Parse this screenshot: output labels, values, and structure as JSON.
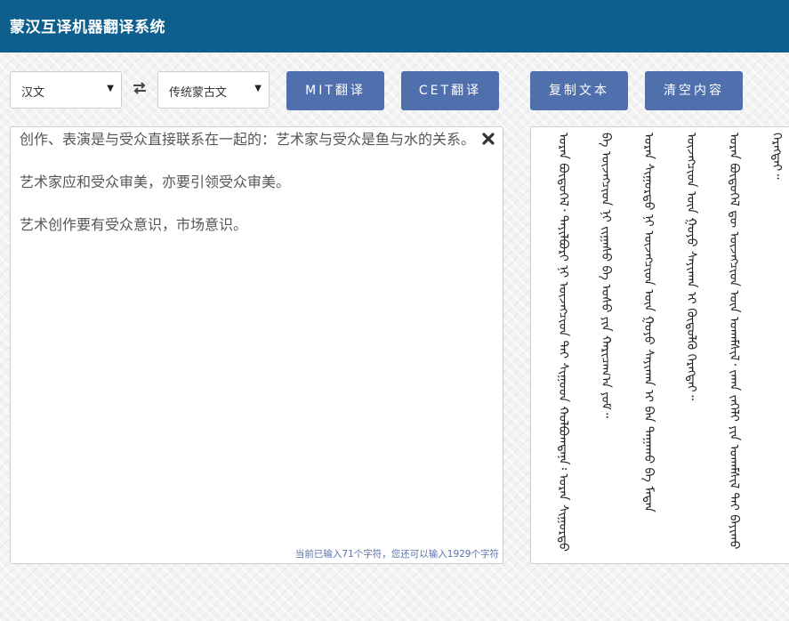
{
  "header": {
    "title": "蒙汉互译机器翻译系统"
  },
  "source_lang": {
    "selected": "汉文"
  },
  "target_lang": {
    "selected": "传统蒙古文"
  },
  "buttons": {
    "mit": "MIT翻译",
    "cet": "CET翻译",
    "copy": "复制文本",
    "clear": "清空内容"
  },
  "input": {
    "paragraphs": [
      "创作、表演是与受众直接联系在一起的：艺术家与受众是鱼与水的关系。",
      "艺术家应和受众审美，亦要引领受众审美。",
      "艺术创作要有受众意识，市场意识。"
    ],
    "counter": "当前已输入71个字符，您还可以输入1929个字符"
  },
  "output": {
    "lines": [
      "ᠤᠷᠠᠨ ᠪᠦᠲᠦᠭᠡᠯ᠂ ᠲᠠᠶᠢᠯᠪᠤᠷᠢ ᠨᠢ ᠦᠵᠡᠭᠴᠢᠳ ᠲᠠᠢ ᠰᠢᠭ᠋ᠤᠳ ᠬᠣᠯᠪᠣᠭᠳᠠᠨᠠ᠄ ᠤᠷᠠᠨ ᠰᠢᠭᠤᠷᠲᠦ ᠪᠠ ᠦᠵᠡᠭᠴᠢᠳ ᠨᠢ ᠵᠢᠭᠠᠰᠤ ᠪᠠ ᠤᠰᠤ ᠶᠢᠨ ᠬᠠᠷᠢᠴᠠᠭ᠎ᠠ ᠶᠤᠮ᠃",
      "ᠤᠷᠠᠨ ᠰᠢᠭᠤᠷᠲᠦ ᠨᠢ ᠦᠵᠡᠭᠴᠢᠳ ᠦᠨ ᠭᠣᠶᠣ ᠰᠠᠶᠢᠬᠠᠨ ᠢ ᠪᠡᠨ ᠳᠠᠭᠠᠬᠤ ᠪᠠ ᠮᠡᠳᠡᠨ ᠦᠵᠡᠭᠴᠢᠳ ᠦᠨ ᠭᠣᠶᠣ ᠰᠠᠶᠢᠬᠠᠨ ᠢ ᠬᠦᠲᠦᠯᠬᠦ ᠬᠡᠷᠡᠭᠲᠡᠢ᠃",
      "ᠤᠷᠠᠨ ᠪᠦᠲᠦᠭᠡᠯ ᠳᠦ ᠦᠵᠡᠭᠴᠢᠳ ᠦᠨ ᠤᠬᠠᠮᠰᠢᠯ᠂ ᠵᠠᠬᠠ ᠵᠡᠭᠡᠯᠢ ᠶᠢᠨ ᠤᠬᠠᠮᠰᠢᠯ ᠲᠠᠢ ᠪᠠᠶᠢᠬᠤ ᠬᠡᠷᠡᠭᠲᠡᠢ᠃"
    ]
  },
  "icons": {
    "swap": "swap-icon",
    "clear": "close-icon"
  },
  "colors": {
    "header": "#0f5f8e",
    "button": "#4f6fad",
    "counter": "#5a72a8"
  }
}
